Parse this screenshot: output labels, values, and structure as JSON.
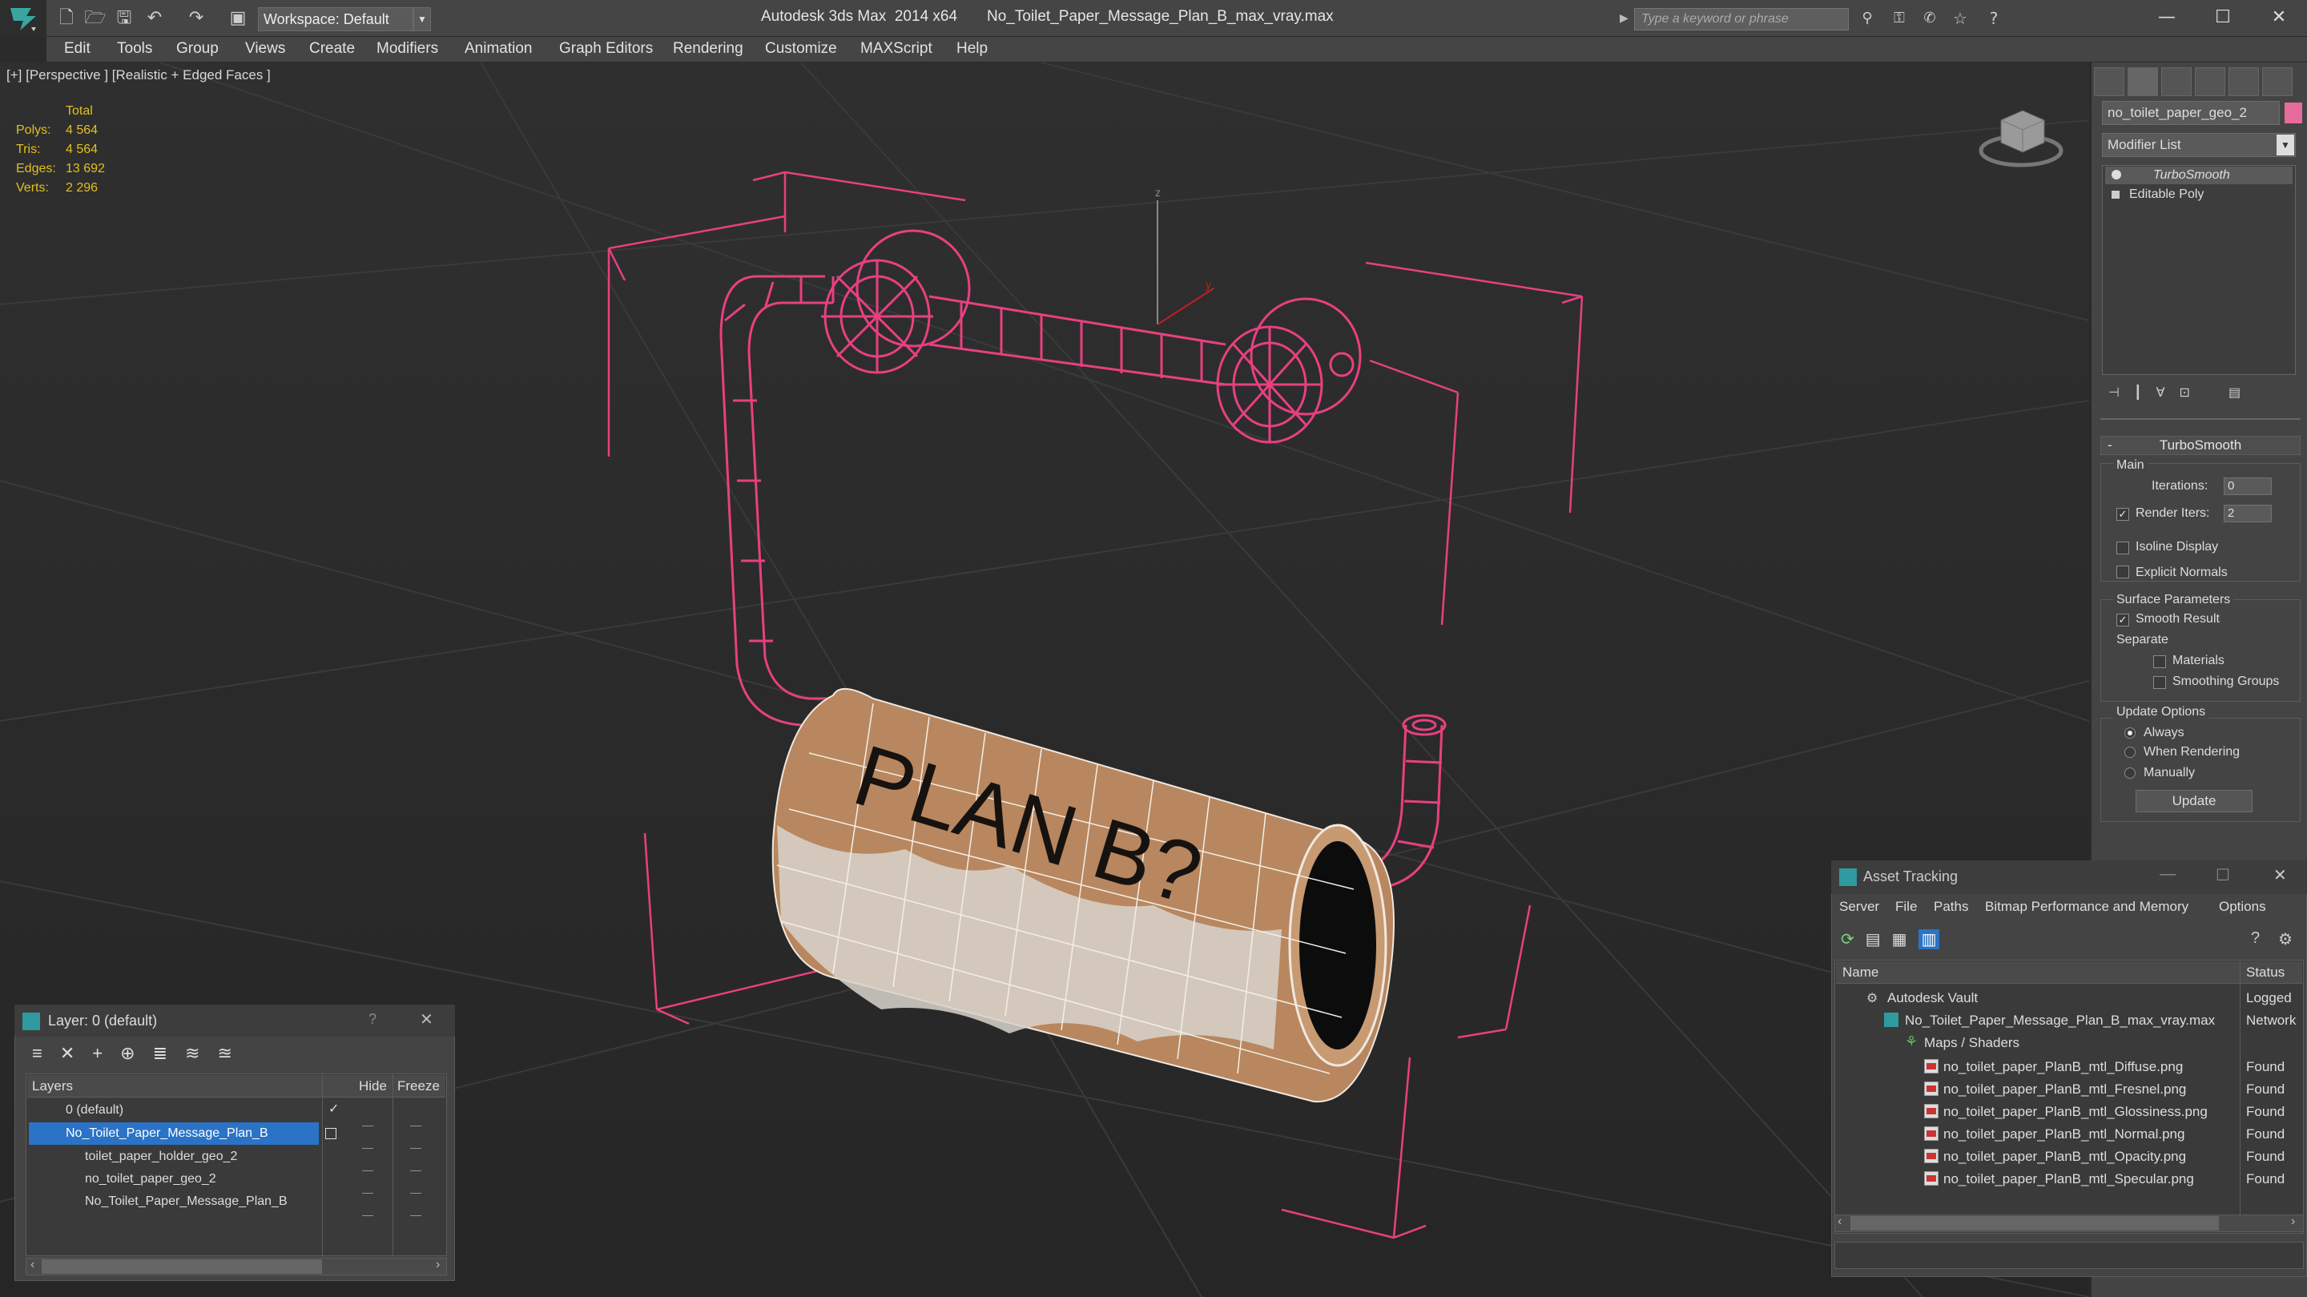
{
  "titlebar": {
    "app": "Autodesk 3ds Max  2014 x64",
    "file": "No_Toilet_Paper_Message_Plan_B_max_vray.max",
    "workspace": "Workspace: Default",
    "search_placeholder": "Type a keyword or phrase"
  },
  "menu": [
    "Edit",
    "Tools",
    "Group",
    "Views",
    "Create",
    "Modifiers",
    "Animation",
    "Graph Editors",
    "Rendering",
    "Customize",
    "MAXScript",
    "Help"
  ],
  "viewport": {
    "label": "[+] [Perspective ] [Realistic + Edged Faces ]",
    "stats": {
      "total": "Total",
      "polys_label": "Polys:",
      "polys": "4 564",
      "tris_label": "Tris:",
      "tris": "4 564",
      "edges_label": "Edges:",
      "edges": "13 692",
      "verts_label": "Verts:",
      "verts": "2 296"
    },
    "roll_text": "PLAN B?",
    "axis_z": "z",
    "axis_y": "y"
  },
  "command_panel": {
    "object_name": "no_toilet_paper_geo_2",
    "modifier_list": "Modifier List",
    "stack": [
      "TurboSmooth",
      "Editable Poly"
    ],
    "rollout_title": "TurboSmooth",
    "main": "Main",
    "iterations_label": "Iterations:",
    "iterations": "0",
    "render_iters_label": "Render Iters:",
    "render_iters": "2",
    "isoline": "Isoline Display",
    "explicit_normals": "Explicit Normals",
    "surface_params": "Surface Parameters",
    "smooth_result": "Smooth Result",
    "separate": "Separate",
    "materials": "Materials",
    "smoothing_groups": "Smoothing Groups",
    "update_options": "Update Options",
    "always": "Always",
    "when_rendering": "When Rendering",
    "manually": "Manually",
    "update": "Update"
  },
  "layers": {
    "title": "Layer: 0 (default)",
    "help": "?",
    "col_layers": "Layers",
    "col_hide": "Hide",
    "col_freeze": "Freeze",
    "rows": [
      "0 (default)",
      "No_Toilet_Paper_Message_Plan_B",
      "toilet_paper_holder_geo_2",
      "no_toilet_paper_geo_2",
      "No_Toilet_Paper_Message_Plan_B"
    ]
  },
  "asset": {
    "title": "Asset Tracking",
    "menu": [
      "Server",
      "File",
      "Paths",
      "Bitmap Performance and Memory",
      "Options"
    ],
    "col_name": "Name",
    "col_status": "Status",
    "rows": [
      {
        "name": "Autodesk Vault",
        "status": "Logged C"
      },
      {
        "name": "No_Toilet_Paper_Message_Plan_B_max_vray.max",
        "status": "Network"
      },
      {
        "name": "Maps / Shaders",
        "status": ""
      },
      {
        "name": "no_toilet_paper_PlanB_mtl_Diffuse.png",
        "status": "Found"
      },
      {
        "name": "no_toilet_paper_PlanB_mtl_Fresnel.png",
        "status": "Found"
      },
      {
        "name": "no_toilet_paper_PlanB_mtl_Glossiness.png",
        "status": "Found"
      },
      {
        "name": "no_toilet_paper_PlanB_mtl_Normal.png",
        "status": "Found"
      },
      {
        "name": "no_toilet_paper_PlanB_mtl_Opacity.png",
        "status": "Found"
      },
      {
        "name": "no_toilet_paper_PlanB_mtl_Specular.png",
        "status": "Found"
      }
    ]
  },
  "colors": {
    "selection": "#e8407f",
    "accent": "#1e8ad6",
    "stats": "#e0c020",
    "object_color": "#e76b9c"
  }
}
